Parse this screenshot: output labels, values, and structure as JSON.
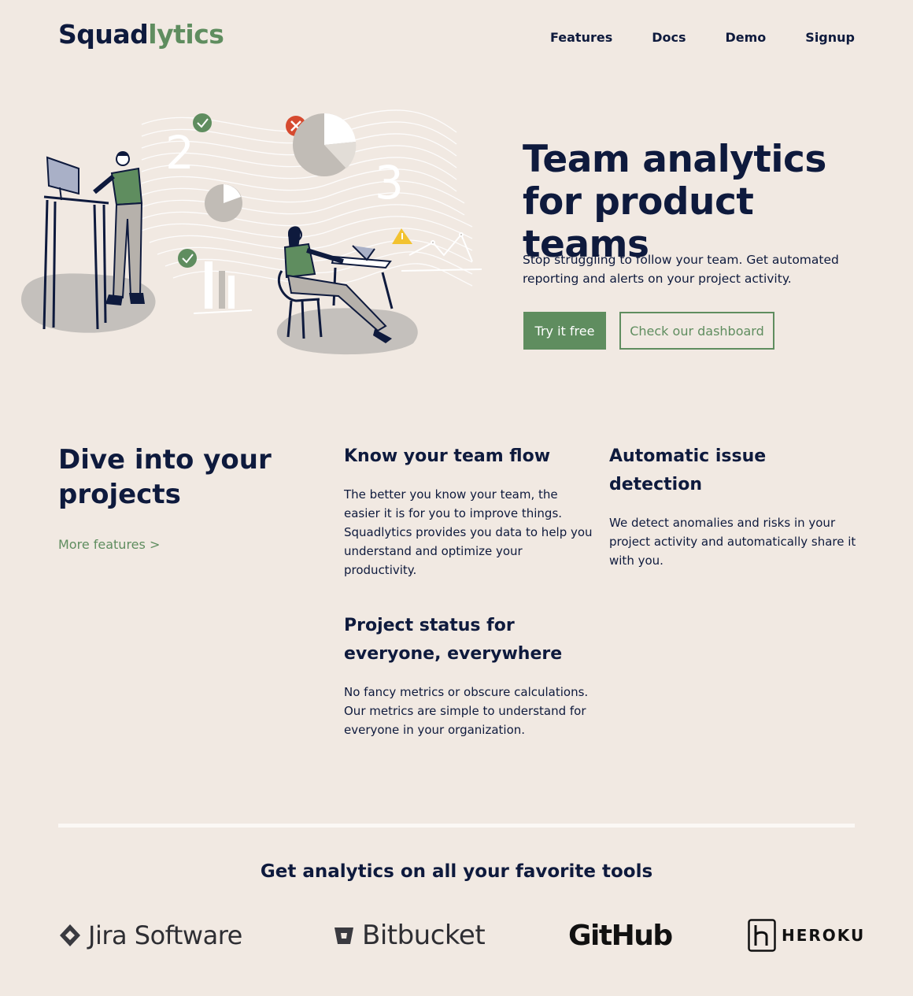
{
  "header": {
    "logo_part1": "Squad",
    "logo_part2": "lytics",
    "nav": [
      {
        "label": "Features"
      },
      {
        "label": "Docs"
      },
      {
        "label": "Demo"
      },
      {
        "label": "Signup"
      }
    ]
  },
  "hero": {
    "title": "Team analytics for product teams",
    "subtitle": "Stop struggling to follow your team. Get automated reporting and alerts on your project activity.",
    "primary_button": "Try it free",
    "secondary_button": "Check our dashboard",
    "illustration_numbers": [
      "2",
      "3"
    ]
  },
  "features": {
    "heading": "Dive into your projects",
    "more_link": "More features >",
    "items": [
      {
        "title": "Know your team flow",
        "text": "The better you know your team, the easier it is for you to improve things. Squadlytics provides you data to help you understand and optimize your productivity."
      },
      {
        "title": "Automatic issue detection",
        "text": "We detect anomalies and risks in your project activity and automatically share it with you."
      },
      {
        "title": "Project status for everyone, everywhere",
        "text": "No fancy metrics or obscure calculations. Our metrics are simple to understand for everyone in your organization."
      }
    ]
  },
  "tools": {
    "heading": "Get analytics on all your favorite tools",
    "logos": [
      {
        "name": "Jira Software",
        "icon": "jira-icon"
      },
      {
        "name": "Bitbucket",
        "icon": "bitbucket-icon"
      },
      {
        "name": "GitHub",
        "icon": ""
      },
      {
        "name": "HEROKU",
        "icon": "heroku-icon"
      }
    ]
  },
  "colors": {
    "background": "#f1e9e2",
    "navy": "#0e1a3d",
    "accent_green": "#5f8d5f",
    "alert_red": "#d64a2f",
    "warning_yellow": "#f2c230"
  }
}
